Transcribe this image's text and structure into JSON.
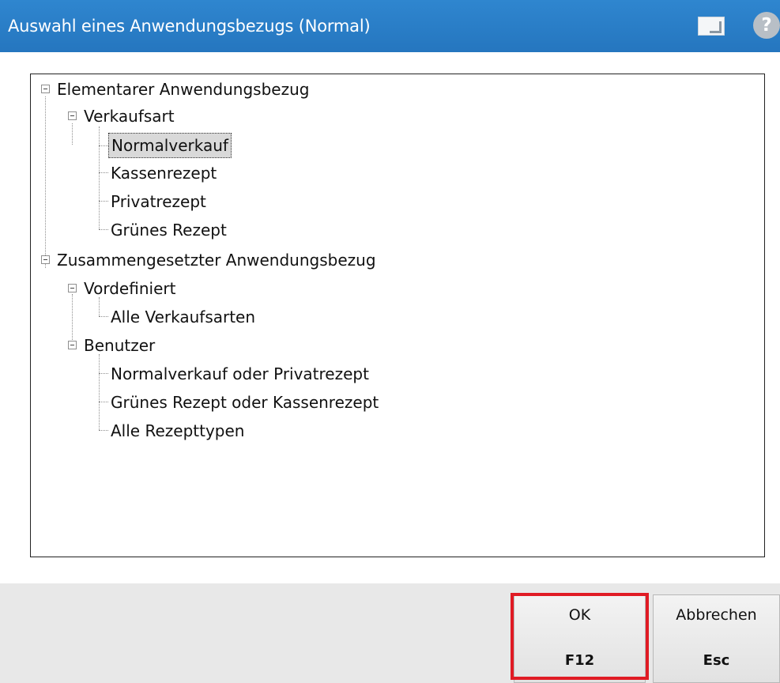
{
  "window": {
    "title": "Auswahl eines Anwendungsbezugs (Normal)",
    "help_glyph": "?",
    "icons": [
      "window-restore-icon",
      "help-icon"
    ]
  },
  "tree": {
    "nodes": [
      {
        "label": "Elementarer Anwendungsbezug",
        "level": 0,
        "expanded": true
      },
      {
        "label": "Verkaufsart",
        "level": 1,
        "expanded": true
      },
      {
        "label": "Normalverkauf",
        "level": 2,
        "selected": true
      },
      {
        "label": "Kassenrezept",
        "level": 2
      },
      {
        "label": "Privatrezept",
        "level": 2
      },
      {
        "label": "Grünes Rezept",
        "level": 2
      },
      {
        "label": "Zusammengesetzter Anwendungsbezug",
        "level": 0,
        "expanded": true
      },
      {
        "label": "Vordefiniert",
        "level": 1,
        "expanded": true
      },
      {
        "label": "Alle Verkaufsarten",
        "level": 2
      },
      {
        "label": "Benutzer",
        "level": 1,
        "expanded": true
      },
      {
        "label": "Normalverkauf oder Privatrezept",
        "level": 2
      },
      {
        "label": "Grünes Rezept oder Kassenrezept",
        "level": 2
      },
      {
        "label": "Alle Rezepttypen",
        "level": 2
      }
    ]
  },
  "buttons": {
    "ok": {
      "label": "OK",
      "key": "F12"
    },
    "cancel": {
      "label": "Abbrechen",
      "key": "Esc"
    }
  },
  "colors": {
    "titlebar": "#2a7dc6",
    "highlight": "#e01b24",
    "selection": "#d9d9d9"
  }
}
